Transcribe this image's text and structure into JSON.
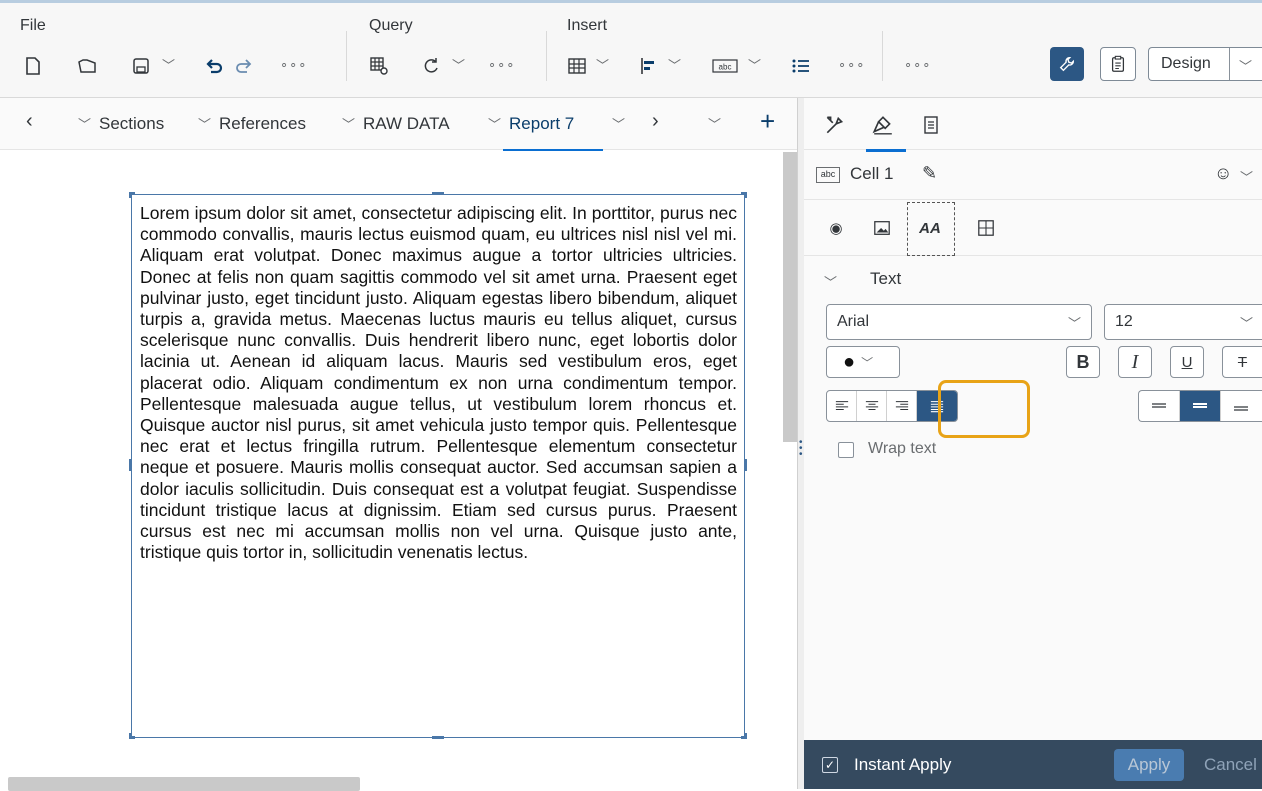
{
  "toolbar": {
    "groups": {
      "file": "File",
      "query": "Query",
      "insert": "Insert"
    },
    "more": "∘∘∘",
    "design_label": "Design"
  },
  "tabs": {
    "items": [
      "Sections",
      "References",
      "RAW DATA",
      "Report 7"
    ],
    "active": "Report 7"
  },
  "textbox": {
    "content": "Lorem ipsum dolor sit amet, consectetur adipiscing elit. In porttitor, purus nec commodo convallis, mauris lectus euismod quam, eu ultrices nisl nisl vel mi. Aliquam erat volutpat. Donec maximus augue a tortor ultricies ultricies. Donec at felis non quam sagittis commodo vel sit amet urna. Praesent eget pulvinar justo, eget tincidunt justo. Aliquam egestas libero bibendum, aliquet turpis a, gravida metus. Maecenas luctus mauris eu tellus aliquet, cursus scelerisque nunc convallis. Duis hendrerit libero nunc, eget lobortis dolor lacinia ut. Aenean id aliquam lacus. Mauris sed vestibulum eros, eget placerat odio. Aliquam condimentum ex non urna condimentum tempor. Pellentesque malesuada augue tellus, ut vestibulum lorem rhoncus et. Quisque auctor nisl purus, sit amet vehicula justo tempor quis. Pellentesque nec erat et lectus fringilla rutrum. Pellentesque elementum consectetur neque et posuere. Mauris mollis consequat auctor. Sed accumsan sapien a dolor iaculis sollicitudin. Duis consequat est a volutpat feugiat. Suspendisse tincidunt tristique lacus at dignissim. Etiam sed cursus purus. Praesent cursus est nec mi accumsan mollis non vel urna. Quisque justo ante, tristique quis tortor in, sollicitudin venenatis lectus."
  },
  "panel": {
    "cell_name": "Cell 1",
    "cell_type_icon": "abc",
    "section_title": "Text",
    "font_family": "Arial",
    "font_size": "12",
    "bold_label": "B",
    "italic_label": "I",
    "underline_label": "U",
    "strike_label": "T",
    "wrap_text_label": "Wrap text",
    "wrap_text_checked": false,
    "horizontal_alignment": "justify",
    "vertical_alignment": "middle",
    "instant_apply_label": "Instant Apply",
    "instant_apply_checked": true,
    "apply_label": "Apply",
    "cancel_label": "Cancel"
  },
  "colors": {
    "accent": "#2c5784",
    "highlight": "#e8a317",
    "footer": "#354a5f",
    "tab_underline": "#0a6ed1"
  }
}
